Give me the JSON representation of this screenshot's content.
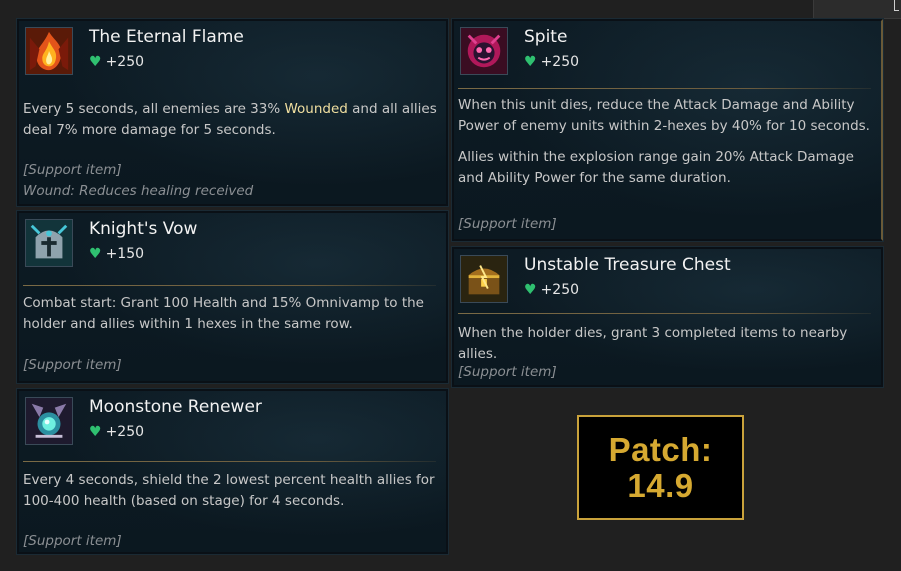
{
  "items": [
    {
      "name": "The Eternal Flame",
      "cost": "+250",
      "desc_before": "Every 5 seconds, all enemies are 33% ",
      "desc_highlight": "Wounded",
      "desc_after": " and all allies deal 7% more damage for 5 seconds.",
      "note1": "[Support item]",
      "note2": "Wound: Reduces healing received",
      "icon": "flame-icon"
    },
    {
      "name": "Spite",
      "cost": "+250",
      "desc_p1": "When this unit dies, reduce the Attack Damage and Ability Power of enemy units within 2-hexes by 40% for 10 seconds.",
      "desc_p2": "Allies within the explosion range gain 20% Attack Damage and Ability Power for the same duration.",
      "note1": "[Support item]",
      "icon": "spite-icon"
    },
    {
      "name": "Knight's Vow",
      "cost": "+150",
      "desc": "Combat start: Grant 100 Health and 15% Omnivamp to the holder and allies within 1 hexes in the same row.",
      "note1": "[Support item]",
      "icon": "knight-helmet-icon"
    },
    {
      "name": "Unstable Treasure Chest",
      "cost": "+250",
      "desc": "When the holder dies, grant 3 completed items to nearby allies.",
      "note1": "[Support item]",
      "icon": "treasure-chest-icon"
    },
    {
      "name": "Moonstone Renewer",
      "cost": "+250",
      "desc": "Every 4 seconds, shield the 2 lowest percent health allies for 100-400 health (based on stage) for 4 seconds.",
      "note1": "[Support item]",
      "icon": "moonstone-icon"
    }
  ],
  "patch": {
    "label": "Patch:",
    "version": "14.9"
  },
  "colors": {
    "heart": "#2fc070",
    "highlight": "#f0dfa0",
    "patch_gold": "#d6a931"
  }
}
